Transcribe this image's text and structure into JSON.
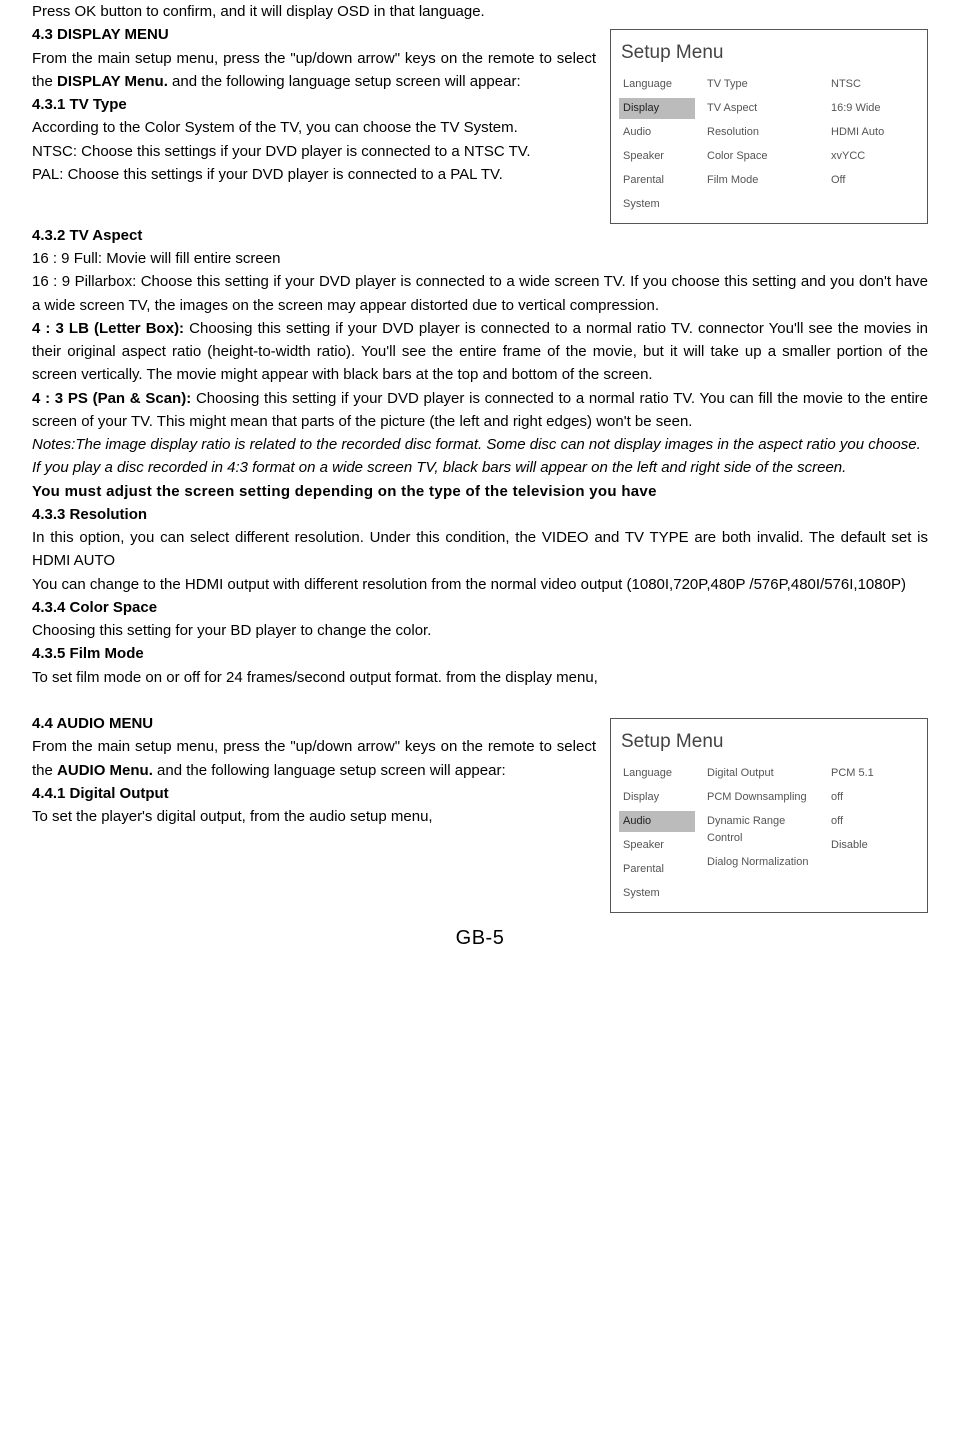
{
  "p0": "Press OK button to confirm, and it will display OSD in that language.",
  "h43": "4.3 DISPLAY MENU",
  "s43a": "From the main setup menu, press the \"up/down arrow\" keys on the remote to select the ",
  "s43b": "DISPLAY Menu.",
  "s43c": "  and the following language setup screen will appear:",
  "h431": "4.3.1 TV Type",
  "s431a": "According to the Color System of the TV, you can choose the TV System.",
  "s431b": "NTSC: Choose this settings if your DVD player is connected to a NTSC TV.",
  "s431c": "PAL: Choose this settings if your DVD player is connected to a PAL TV.",
  "h432": "4.3.2 TV Aspect",
  "s432a": "16 : 9 Full:   Movie will fill entire screen",
  "s432b": "16 : 9 Pillarbox: Choose this setting if your DVD player is connected to a wide screen TV. If you choose this setting and you don't have a wide screen TV, the images on the screen may appear distorted due to vertical compression.",
  "s432c1": "4 : 3 LB (Letter Box): ",
  "s432c2": "Choosing this setting if your DVD player is connected to a normal ratio TV. connector You'll see the movies in their original aspect ratio (height-to-width ratio). You'll see the entire frame of the movie, but it will take up a smaller portion of the screen vertically. The movie might appear with black bars at the top and bottom of the screen.",
  "s432d1": "4 : 3 PS (Pan & Scan): ",
  "s432d2": "Choosing this setting if your DVD player is connected to a normal ratio TV. You can fill the movie to the entire screen of your TV. This might mean that parts of the picture (the left and right edges) won't be seen.",
  "note1": "Notes:The image display ratio is related to the recorded disc format. Some disc can not display images in the aspect ratio you choose.",
  "note2": "If you play a disc recorded in 4:3 format on a wide screen TV, black bars will appear on the left and right side of the screen.",
  "mustline": "You must adjust the screen setting depending on the type of the television you have",
  "h433": "4.3.3 Resolution",
  "s433a": "In this option, you can select different resolution. Under this condition, the VIDEO and TV TYPE are both invalid. The default set is HDMI AUTO",
  "s433b": "You can change to the HDMI output with different resolution from the normal video output (1080I,720P,480P /576P,480I/576I,1080P)",
  "h434": "4.3.4 Color Space",
  "s434": "Choosing this setting for your BD player to change the color.",
  "h435": "4.3.5 Film Mode",
  "s435": "To set film mode on or off for 24 frames/second output format. from the display menu,",
  "h44": "4.4 AUDIO MENU",
  "s44a": "From the main setup menu, press the \"up/down arrow\" keys on the remote to select the ",
  "s44b": "AUDIO Menu.",
  "s44c": "   and the following language setup screen will appear:",
  "h441": "4.4.1 Digital Output",
  "s441": "To set the player's digital output, from the audio setup menu,",
  "pagenum": "GB-5",
  "fig1": {
    "title": "Setup Menu",
    "side": [
      "Language",
      "Display",
      "Audio",
      "Speaker",
      "Parental",
      "System"
    ],
    "mid": [
      "TV Type",
      "TV Aspect",
      "Resolution",
      "Color Space",
      "Film Mode"
    ],
    "val": [
      "NTSC",
      "16:9 Wide",
      "HDMI Auto",
      "xvYCC",
      "Off"
    ],
    "selected_index": 1
  },
  "fig2": {
    "title": "Setup Menu",
    "side": [
      "Language",
      "Display",
      "Audio",
      "Speaker",
      "Parental",
      "System"
    ],
    "mid": [
      "Digital Output",
      "PCM Downsampling",
      "Dynamic Range Control",
      "Dialog Normalization"
    ],
    "val": [
      "PCM 5.1",
      "off",
      "off",
      "Disable"
    ],
    "selected_index": 2
  }
}
